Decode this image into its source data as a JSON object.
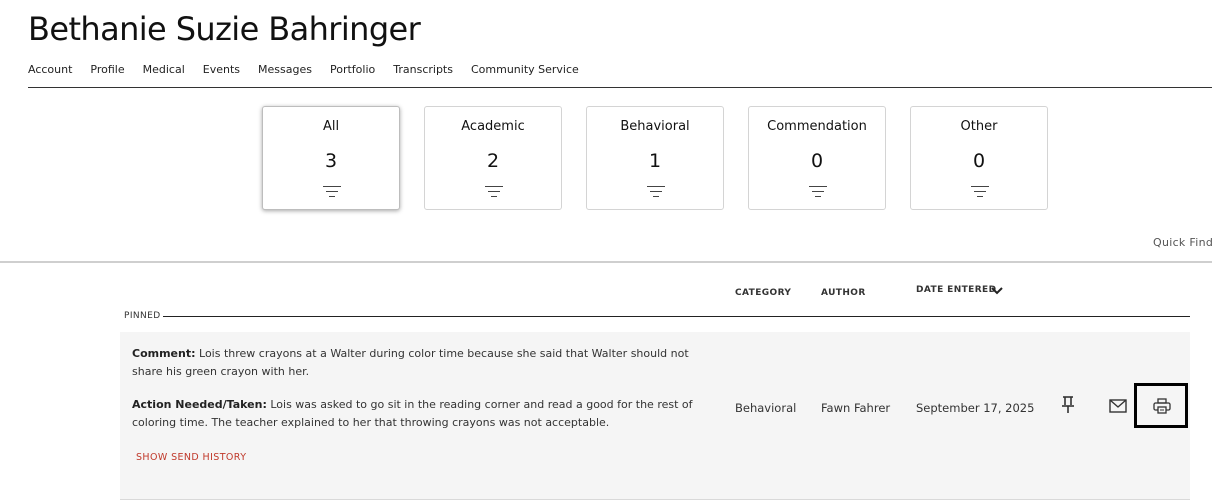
{
  "student": {
    "name": "Bethanie Suzie Bahringer"
  },
  "nav": [
    "Account",
    "Profile",
    "Medical",
    "Events",
    "Messages",
    "Portfolio",
    "Transcripts",
    "Community Service"
  ],
  "filters": [
    {
      "label": "All",
      "count": "3",
      "active": true
    },
    {
      "label": "Academic",
      "count": "2",
      "active": false
    },
    {
      "label": "Behavioral",
      "count": "1",
      "active": false
    },
    {
      "label": "Commendation",
      "count": "0",
      "active": false
    },
    {
      "label": "Other",
      "count": "0",
      "active": false
    }
  ],
  "quick_find_label": "Quick Find",
  "columns": {
    "category": "CATEGORY",
    "author": "AUTHOR",
    "date_entered": "DATE ENTERED"
  },
  "pinned_label": "PINNED",
  "entry": {
    "comment_label": "Comment:",
    "comment_text": " Lois threw crayons at a Walter during color time because she said that Walter should not share his green crayon with her.",
    "action_label": "Action Needed/Taken:",
    "action_text": " Lois was asked to go sit in the reading corner and read a good for the rest of coloring time. The teacher explained to her that throwing crayons was not acceptable.",
    "category": "Behavioral",
    "author": "Fawn Fahrer",
    "date": "September 17, 2025",
    "send_history_label": "SHOW SEND HISTORY"
  },
  "icons": {
    "pin": "pin-icon",
    "mail": "mail-icon",
    "print": "print-icon",
    "filter": "filter-icon",
    "sort": "chevron-down-icon"
  },
  "colors": {
    "link_red": "#c0392b",
    "row_bg": "#f5f5f5",
    "highlight_border": "#000000"
  }
}
